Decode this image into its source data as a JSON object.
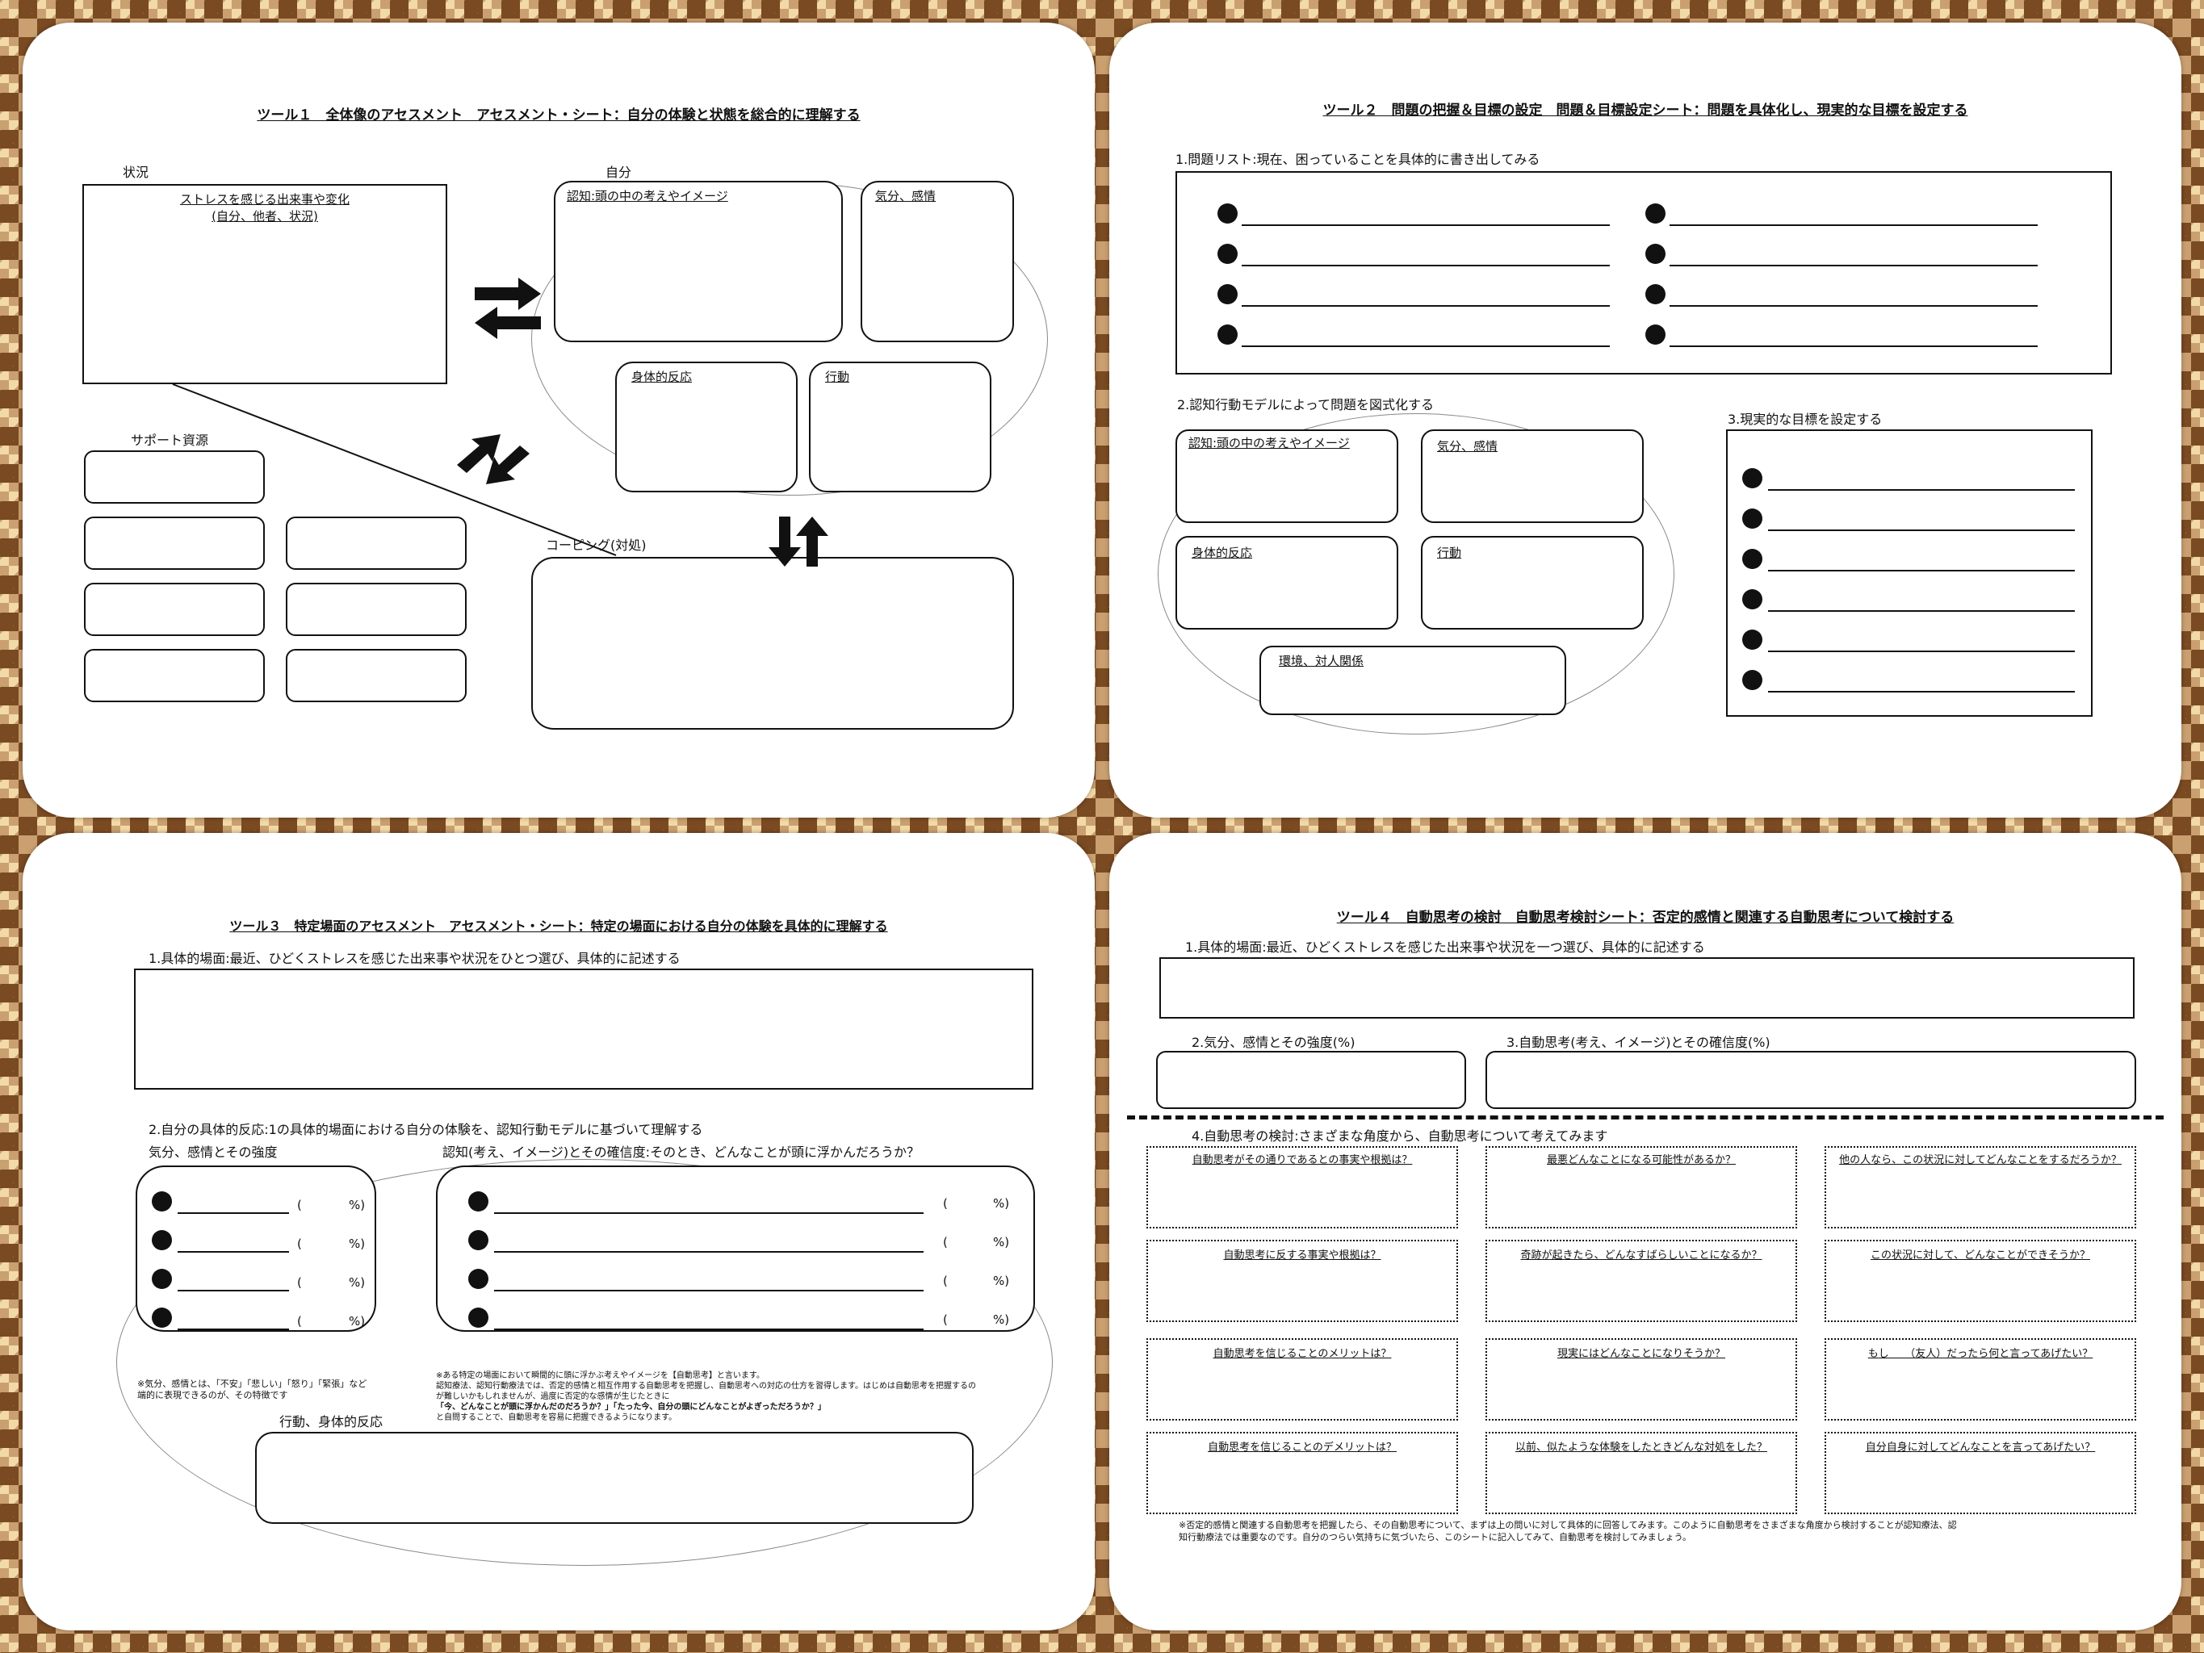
{
  "tool1": {
    "title": "ツール１　全体像のアセスメント　アセスメント・シート：自分の体験と状態を総合的に理解する",
    "situation_label": "状況",
    "situation_box": "ストレスを感じる出来事や変化",
    "situation_box_sub": "(自分、他者、状況)",
    "self_label": "自分",
    "cognition": "認知:頭の中の考えやイメージ",
    "mood": "気分、感情",
    "body": "身体的反応",
    "behavior": "行動",
    "support_label": "サポート資源",
    "coping_label": "コーピング(対処)"
  },
  "tool2": {
    "title": "ツール２　問題の把握＆目標の設定　問題＆目標設定シート：問題を具体化し、現実的な目標を設定する",
    "problem_list_label": "1.問題リスト:現在、困っていることを具体的に書き出してみる",
    "model_label": "2.認知行動モデルによって問題を図式化する",
    "cognition": "認知:頭の中の考えやイメージ",
    "mood": "気分、感情",
    "body": "身体的反応",
    "behavior": "行動",
    "environment": "環境、対人関係",
    "goals_label": "3.現実的な目標を設定する"
  },
  "tool3": {
    "title": "ツール３　特定場面のアセスメント　アセスメント・シート：特定の場面における自分の体験を具体的に理解する",
    "scene_label": "1.具体的場面:最近、ひどくストレスを感じた出来事や状況をひとつ選び、具体的に記述する",
    "reaction_label": "2.自分の具体的反応:1の具体的場面における自分の体験を、認知行動モデルに基づいて理解する",
    "mood_label": "気分、感情とその強度",
    "cognition_label": "認知(考え、イメージ)とその確信度:そのとき、どんなことが頭に浮かんだろうか？",
    "paren_open": "(",
    "percent": "%)",
    "mood_note_1": "※気分、感情とは、「不安」「悲しい」「怒り」「緊張」など",
    "mood_note_2": "端的に表現できるのが、その特徴です",
    "cog_note_1": "※ある特定の場面において瞬間的に頭に浮かぶ考えやイメージを【自動思考】と言います。",
    "cog_note_2": "認知療法、認知行動療法では、否定的感情と相互作用する自動思考を把握し、自動思考への対応の仕方を習得します。はじめは自動思考を把握するの",
    "cog_note_3": "が難しいかもしれませんが、過度に否定的な感情が生じたときに",
    "cog_note_4": "「今、どんなことが頭に浮かんだのだろうか？」「たった今、自分の頭にどんなことがよぎっただろうか？」",
    "cog_note_5": "と自問することで、自動思考を容易に把握できるようになります。",
    "behavior_label": "行動、身体的反応"
  },
  "tool4": {
    "title": "ツール４　自動思考の検討　自動思考検討シート：否定的感情と関連する自動思考について検討する",
    "scene_label": "1.具体的場面:最近、ひどくストレスを感じた出来事や状況を一つ選び、具体的に記述する",
    "mood_label": "2.気分、感情とその強度(%)",
    "thought_label": "3.自動思考(考え、イメージ)とその確信度(%)",
    "review_label": "4.自動思考の検討:さまざまな角度から、自動思考について考えてみます",
    "questions": [
      "自動思考がその通りであるとの事実や根拠は？",
      "最悪どんなことになる可能性があるか？",
      "他の人なら、この状況に対してどんなことをするだろうか？",
      "自動思考に反する事実や根拠は？",
      "奇跡が起きたら、どんなすばらしいことになるか？",
      "この状況に対して、どんなことができそうか？",
      "自動思考を信じることのメリットは？",
      "現実にはどんなことになりそうか？",
      "もし　　（友人）だったら何と言ってあげたい？",
      "自動思考を信じることのデメリットは？",
      "以前、似たような体験をしたときどんな対処をした？",
      "自分自身に対してどんなことを言ってあげたい？"
    ],
    "note_1": "※否定的感情と関連する自動思考を把握したら、その自動思考について、まずは上の問いに対して具体的に回答してみます。このように自動思考をさまざまな角度から検討することが認知療法、認",
    "note_2": "知行動療法では重要なのです。自分のつらい気持ちに気づいたら、このシートに記入してみて、自動思考を検討してみましょう。"
  }
}
